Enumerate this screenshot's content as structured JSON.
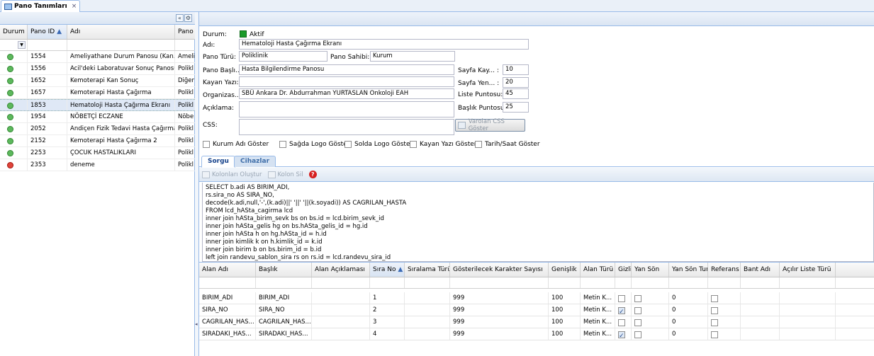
{
  "app": {
    "tab_title": "Pano Tanımları",
    "tab_close": "×"
  },
  "left": {
    "collapse_btn": "«",
    "columns": [
      "Durum",
      "Pano ID",
      "Adı",
      "Pano"
    ],
    "rows": [
      {
        "status": "active",
        "id": "1554",
        "name": "Ameliyathane Durum Panosu (Kan...",
        "type": "Ameli"
      },
      {
        "status": "active",
        "id": "1556",
        "name": "Acil'deki Laboratuvar Sonuç Panosu",
        "type": "Polikl"
      },
      {
        "status": "active",
        "id": "1652",
        "name": "Kemoterapi Kan Sonuç",
        "type": "Diğer"
      },
      {
        "status": "active",
        "id": "1657",
        "name": "Kemoterapi Hasta Çağırma",
        "type": "Polikl"
      },
      {
        "status": "active",
        "id": "1853",
        "name": "Hematoloji Hasta Çağırma Ekranı",
        "type": "Polikl"
      },
      {
        "status": "active",
        "id": "1954",
        "name": "NÖBETÇİ ECZANE",
        "type": "Nöbe"
      },
      {
        "status": "active",
        "id": "2052",
        "name": "Andiçen Fizik Tedavi Hasta Çağırma",
        "type": "Polikl"
      },
      {
        "status": "active",
        "id": "2152",
        "name": "Kemoterapi Hasta Çağırma 2",
        "type": "Polikl"
      },
      {
        "status": "active",
        "id": "2253",
        "name": "ÇOCUK HASTALIKLARI",
        "type": "Polikl"
      },
      {
        "status": "inactive",
        "id": "2353",
        "name": "deneme",
        "type": "Polikl"
      }
    ]
  },
  "form": {
    "durum_label": "Durum:",
    "durum_value": "Aktif",
    "adi_label": "Adı:",
    "adi_value": "Hematoloji Hasta Çağırma Ekranı",
    "pano_turu_label": "Pano Türü:",
    "pano_turu_value": "Poliklinik",
    "pano_sahibi_label": "Pano Sahibi:",
    "pano_sahibi_value": "Kurum",
    "pano_basligi_label": "Pano Başlı...",
    "pano_basligi_value": "Hasta Bilgilendirme Panosu",
    "kayan_yazi_label": "Kayan Yazı:",
    "kayan_yazi_value": "",
    "organizasyon_label": "Organizas...",
    "organizasyon_value": "SBÜ Ankara Dr. Abdurrahman YURTASLAN Onkoloji EAH",
    "aciklama_label": "Açıklama:",
    "css_label": "CSS:",
    "css_button": "Varolan CSS Göster",
    "sayfa_kayit_label": "Sayfa Kay... :",
    "sayfa_kayit_value": "10",
    "sayfa_yenileme_label": "Sayfa Yen... :",
    "sayfa_yenileme_value": "20",
    "liste_puntosu_label": "Liste Puntosu:",
    "liste_puntosu_value": "45",
    "baslik_puntosu_label": "Başlık Puntosu:",
    "baslik_puntosu_value": "25",
    "checkboxes": [
      "Kurum Adı Göster",
      "Sağda Logo Göster",
      "Solda Logo Göster",
      "Kayan Yazı Göster",
      "Tarih/Saat Göster"
    ],
    "accent": "#1a9a2a"
  },
  "subtabs": [
    "Sorgu",
    "Cihazlar"
  ],
  "toolbar": {
    "create_columns": "Kolonları Oluştur",
    "delete_column": "Kolon Sil",
    "help": "?"
  },
  "sql_lines": [
    "SELECT b.adi AS BIRIM_ADI,",
    "rs.sira_no AS SIRA_NO,",
    "decode(k.adi,null,'-',(k.adi)||' '||' '||(k.soyadi)) AS CAGRILAN_HASTA",
    "FROM lcd_hASta_cagirma lcd",
    "inner join hASta_birim_sevk bs on bs.id = lcd.birim_sevk_id",
    "inner join hASta_gelis hg on bs.hASta_gelis_id = hg.id",
    "inner join hASta h on hg.hASta_id = h.id",
    "inner join kimlik k on h.kimlik_id = k.id",
    "inner join birim b on bs.birim_id = b.id",
    "left join randevu_sablon_sira rs on rs.id = lcd.randevu_sira_id"
  ],
  "columns_grid": {
    "headers": [
      "Alan Adı",
      "Başlık",
      "Alan Açıklaması",
      "Sıra No",
      "Sıralama Türü",
      "Gösterilecek Karakter Sayısı",
      "Genişlik",
      "Alan Türü",
      "Gizli",
      "Yan Sön",
      "Yan Sön Tur.",
      "Referans",
      "Bant Adı",
      "Açılır Liste Türü"
    ],
    "rows": [
      {
        "alan": "BIRIM_ADI",
        "baslik": "BIRIM_ADI",
        "aciklama": "",
        "sira": "1",
        "siralama": "",
        "karakter": "999",
        "genislik": "100",
        "tur": "Metin K...",
        "gizli": false,
        "yansondur": false,
        "yansontur": "0",
        "referans": false
      },
      {
        "alan": "SIRA_NO",
        "baslik": "SIRA_NO",
        "aciklama": "",
        "sira": "2",
        "siralama": "",
        "karakter": "999",
        "genislik": "100",
        "tur": "Metin K...",
        "gizli": true,
        "yansondur": false,
        "yansontur": "0",
        "referans": false
      },
      {
        "alan": "CAGRILAN_HAS...",
        "baslik": "CAGRILAN_HAS...",
        "aciklama": "",
        "sira": "3",
        "siralama": "",
        "karakter": "999",
        "genislik": "100",
        "tur": "Metin K...",
        "gizli": false,
        "yansondur": false,
        "yansontur": "0",
        "referans": false
      },
      {
        "alan": "SIRADAKI_HAS...",
        "baslik": "SIRADAKI_HAS...",
        "aciklama": "",
        "sira": "4",
        "siralama": "",
        "karakter": "999",
        "genislik": "100",
        "tur": "Metin K...",
        "gizli": true,
        "yansondur": false,
        "yansontur": "0",
        "referans": false
      }
    ]
  }
}
